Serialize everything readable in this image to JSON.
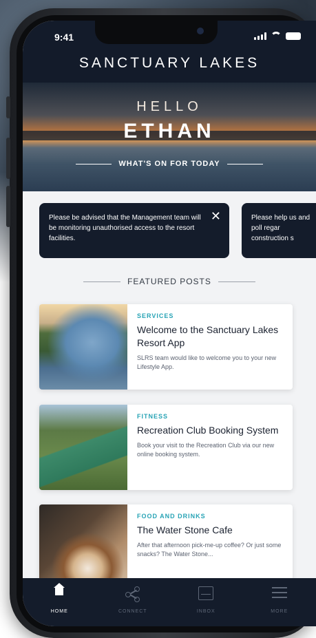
{
  "status_bar": {
    "time": "9:41"
  },
  "header": {
    "brand": "SANCTUARY LAKES"
  },
  "hero": {
    "greeting": "HELLO",
    "name": "ETHAN",
    "subtitle": "WHAT'S ON FOR TODAY"
  },
  "notices": [
    {
      "text": "Please be advised that the Management team will be monitoring unauthorised access to the resort facilities."
    },
    {
      "text": "Please help us and poll regar construction s"
    }
  ],
  "featured": {
    "heading": "FEATURED POSTS"
  },
  "posts": [
    {
      "category": "SERVICES",
      "title": "Welcome to the Sanctuary Lakes Resort App",
      "description": "SLRS team would like to welcome you to your new Lifestyle App."
    },
    {
      "category": "FITNESS",
      "title": "Recreation Club Booking System",
      "description": "Book your visit to the Recreation Club via our new online booking system."
    },
    {
      "category": "FOOD AND DRINKS",
      "title": "The Water Stone Cafe",
      "description": "After that afternoon pick-me-up coffee? Or just some snacks? The Water Stone..."
    }
  ],
  "tabs": [
    {
      "label": "HOME",
      "icon": "home-icon",
      "active": true
    },
    {
      "label": "CONNECT",
      "icon": "share-icon",
      "active": false
    },
    {
      "label": "INBOX",
      "icon": "inbox-icon",
      "active": false
    },
    {
      "label": "MORE",
      "icon": "menu-icon",
      "active": false
    }
  ],
  "colors": {
    "navy": "#131b2a",
    "accent": "#27a3b5",
    "background": "#f2f3f5"
  }
}
